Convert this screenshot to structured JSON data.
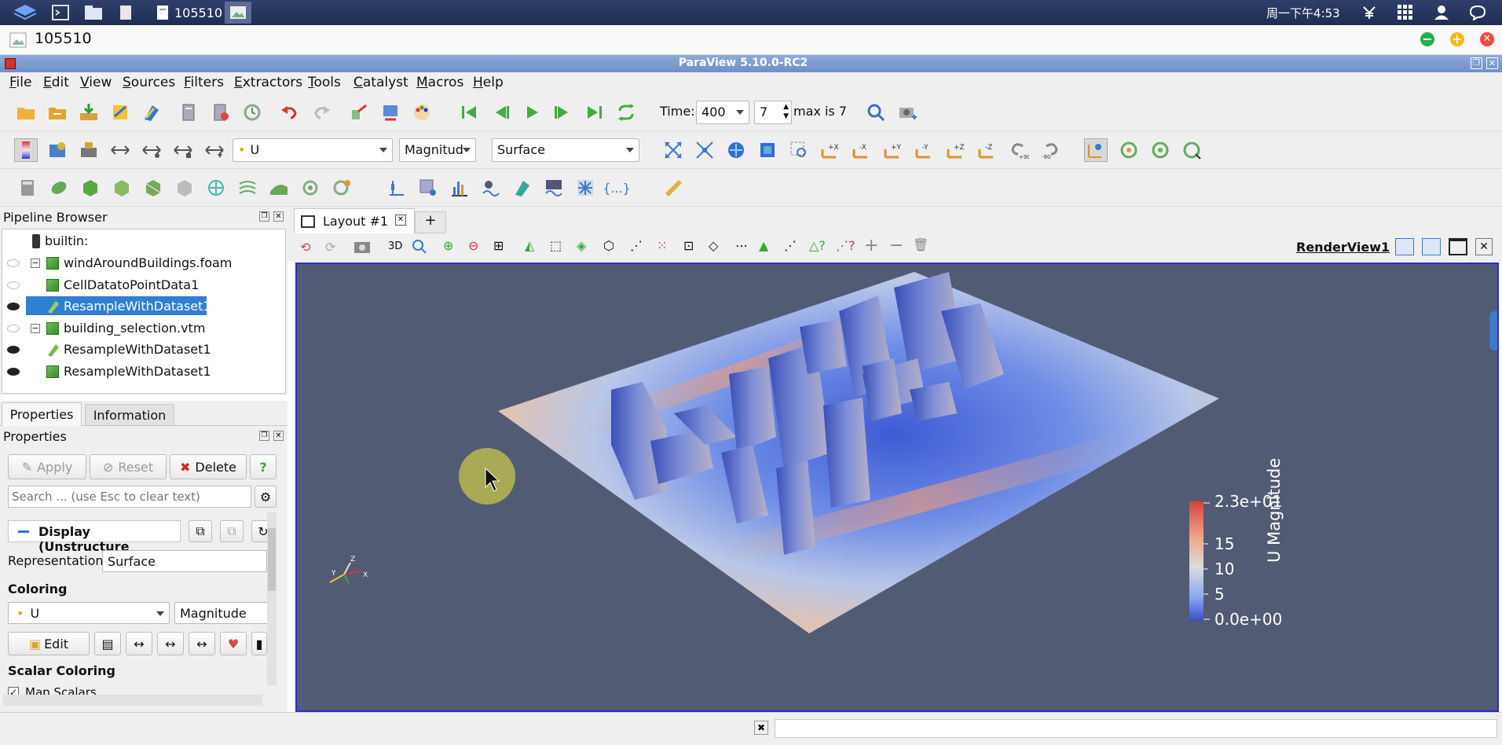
{
  "taskbar": {
    "window_label": "105510",
    "clock": "周一下午4:53"
  },
  "titlebar": {
    "title": "105510"
  },
  "app_title": "ParaView 5.10.0-RC2",
  "menu": [
    "File",
    "Edit",
    "View",
    "Sources",
    "Filters",
    "Extractors",
    "Tools",
    "Catalyst",
    "Macros",
    "Help"
  ],
  "time_toolbar": {
    "time_label": "Time:",
    "time_value": "400",
    "step_value": "7",
    "max_label": "max is 7"
  },
  "color_toolbar": {
    "array": "U",
    "component": "Magnitud",
    "representation": "Surface"
  },
  "pipeline": {
    "title": "Pipeline Browser",
    "items": [
      {
        "label": "builtin:"
      },
      {
        "label": "windAroundBuildings.foam"
      },
      {
        "label": "CellDatatoPointData1"
      },
      {
        "label": "ResampleWithDataset1"
      },
      {
        "label": "building_selection.vtm"
      },
      {
        "label": "ResampleWithDataset1"
      },
      {
        "label": "ResampleWithDataset1"
      }
    ]
  },
  "tabs": {
    "properties": "Properties",
    "information": "Information"
  },
  "properties": {
    "title": "Properties",
    "apply": "Apply",
    "reset": "Reset",
    "delete": "Delete",
    "help": "?",
    "search_placeholder": "Search ... (use Esc to clear text)",
    "display_section": "Display (Unstructure",
    "representation_label": "Representation",
    "representation_value": "Surface",
    "coloring_section": "Coloring",
    "color_array": "U",
    "color_component": "Magnitude",
    "edit_label": "Edit",
    "scalar_coloring_section": "Scalar Coloring",
    "map_scalars": "Map Scalars"
  },
  "layout": {
    "tab_label": "Layout #1",
    "add_tab": "+",
    "view_name": "RenderView1",
    "mode_3d": "3D"
  },
  "colorbar": {
    "title": "U Magnitude",
    "labels": [
      "2.3e+01",
      "15",
      "10",
      "5",
      "0.0e+00"
    ],
    "colors": [
      "#d4423a",
      "#f0a688",
      "#dcdcdc",
      "#8aa8f0",
      "#3b4ccb"
    ]
  },
  "axes": {
    "x": "X",
    "y": "Y",
    "z": "Z"
  },
  "colors": {
    "accent_blue": "#2f7ad6",
    "selection": "#2f7fd2",
    "viewport_bg": "#525b74"
  }
}
